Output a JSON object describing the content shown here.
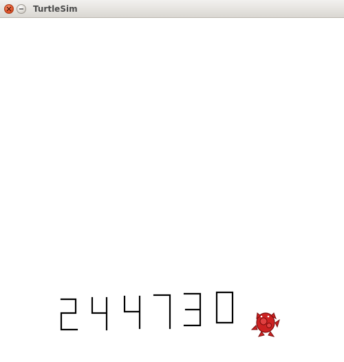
{
  "window": {
    "title": "TurtleSim",
    "buttons": {
      "close": "close-icon",
      "minimize": "minimize-icon"
    }
  },
  "canvas": {
    "background_color": "#ffffff",
    "pen_color": "#000000",
    "drawn_digits": [
      "2",
      "4",
      "4",
      "7",
      "3",
      "0"
    ],
    "turtle": {
      "icon": "turtle-icon",
      "color": "#cc2222"
    }
  }
}
